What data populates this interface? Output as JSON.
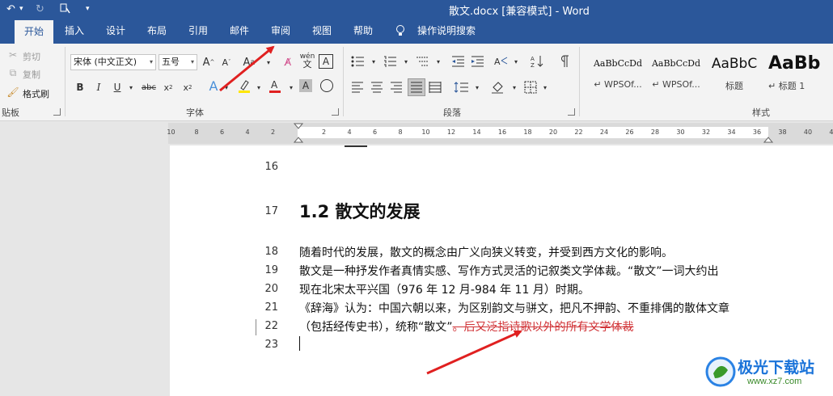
{
  "window": {
    "title": "散文.docx [兼容模式]  -  Word"
  },
  "quick_access": {
    "undo": "↶",
    "redo": "↻",
    "customize": "▾"
  },
  "tabs": [
    {
      "label": "开始",
      "active": true
    },
    {
      "label": "插入"
    },
    {
      "label": "设计"
    },
    {
      "label": "布局"
    },
    {
      "label": "引用"
    },
    {
      "label": "邮件"
    },
    {
      "label": "审阅"
    },
    {
      "label": "视图"
    },
    {
      "label": "帮助"
    },
    {
      "label": "操作说明搜索"
    }
  ],
  "clipboard": {
    "cut": "剪切",
    "copy": "复制",
    "format_painter": "格式刷",
    "group": "贴板"
  },
  "font": {
    "name": "宋体 (中文正文)",
    "size": "五号",
    "group": "字体",
    "aa_text": "A",
    "wen_text": "wén",
    "wen_char": "文",
    "a_box": "A",
    "circle_char": "字"
  },
  "paragraph": {
    "group": "段落"
  },
  "styles": {
    "group": "样式",
    "items": [
      {
        "sample": "AaBbCcDd",
        "name": "WPSOf..."
      },
      {
        "sample": "AaBbCcDd",
        "name": "WPSOf..."
      },
      {
        "sample": "AaBbC",
        "name": "标题"
      },
      {
        "sample": "AaBb",
        "name": "标题 1"
      }
    ]
  },
  "ruler": {
    "ticks": [
      "10",
      "8",
      "6",
      "4",
      "2",
      "2",
      "4",
      "6",
      "8",
      "10",
      "12",
      "14",
      "16",
      "18",
      "20",
      "22",
      "24",
      "26",
      "28",
      "30",
      "32",
      "34",
      "36",
      "38",
      "40",
      "42"
    ]
  },
  "document": {
    "line_numbers": [
      "16",
      "17",
      "18",
      "19",
      "20",
      "21",
      "22",
      "23"
    ],
    "heading": "1.2 散文的发展",
    "lines": [
      "随着时代的发展，散文的概念由广义向狭义转变，并受到西方文化的影响。",
      "散文是一种抒发作者真情实感、写作方式灵活的记叙类文学体裁。“散文”一词大约出",
      "现在北宋太平兴国（976 年 12 月-984 年 11 月）时期。",
      "《辞海》认为：中国六朝以来，为区别韵文与骈文，把凡不押韵、不重排偶的散体文章",
      "（包括经传史书），统称“散文”"
    ],
    "deleted_text": "。后又泛指诗歌以外的所有文学体裁"
  },
  "watermark": {
    "name": "极光下载站",
    "url": "www.xz7.com"
  },
  "colors": {
    "accent": "#2b579a",
    "deleted": "#d13438",
    "arrow": "#e02020"
  }
}
